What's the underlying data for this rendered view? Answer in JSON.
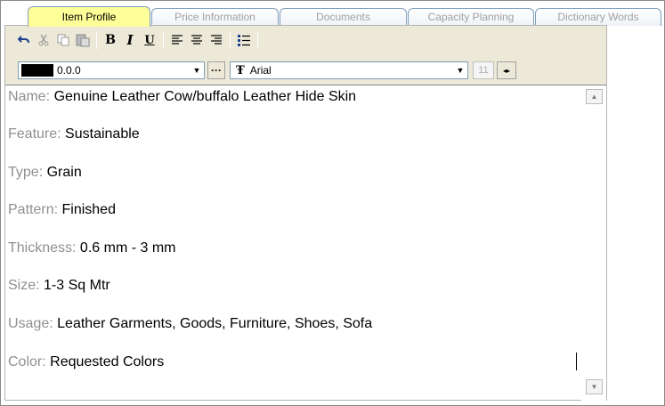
{
  "tabs": [
    {
      "label": "Item Profile",
      "active": true
    },
    {
      "label": "Price Information",
      "active": false
    },
    {
      "label": "Documents",
      "active": false
    },
    {
      "label": "Capacity Planning",
      "active": false
    },
    {
      "label": "Dictionary Words",
      "active": false
    }
  ],
  "toolbar": {
    "undo_icon": "undo-icon",
    "cut_icon": "scissors-icon",
    "copy_icon": "copy-icon",
    "paste_icon": "clipboard-icon",
    "bold_label": "B",
    "italic_label": "I",
    "underline_label": "U",
    "align_left_icon": "align-left-icon",
    "align_center_icon": "align-center-icon",
    "align_right_icon": "align-right-icon",
    "list_icon": "bullet-list-icon"
  },
  "format": {
    "color_value": "0.0.0",
    "swatch_color": "#000000",
    "more_label": "···",
    "font_name": "Arial",
    "font_size": "11"
  },
  "fields": [
    {
      "label": "Name:",
      "value": "Genuine Leather Cow/buffalo Leather Hide Skin"
    },
    {
      "label": "Feature:",
      "value": "Sustainable"
    },
    {
      "label": "Type:",
      "value": "Grain"
    },
    {
      "label": "Pattern:",
      "value": "Finished"
    },
    {
      "label": "Thickness:",
      "value": "0.6 mm - 3 mm"
    },
    {
      "label": "Size:",
      "value": "1-3 Sq Mtr"
    },
    {
      "label": "Usage:",
      "value": "Leather Garments, Goods, Furniture, Shoes, Sofa"
    },
    {
      "label": "Color:",
      "value": "Requested Colors"
    }
  ],
  "colors": {
    "active_tab": "#ffff99",
    "panel_bg": "#ece9d8",
    "label_gray": "#909090"
  }
}
